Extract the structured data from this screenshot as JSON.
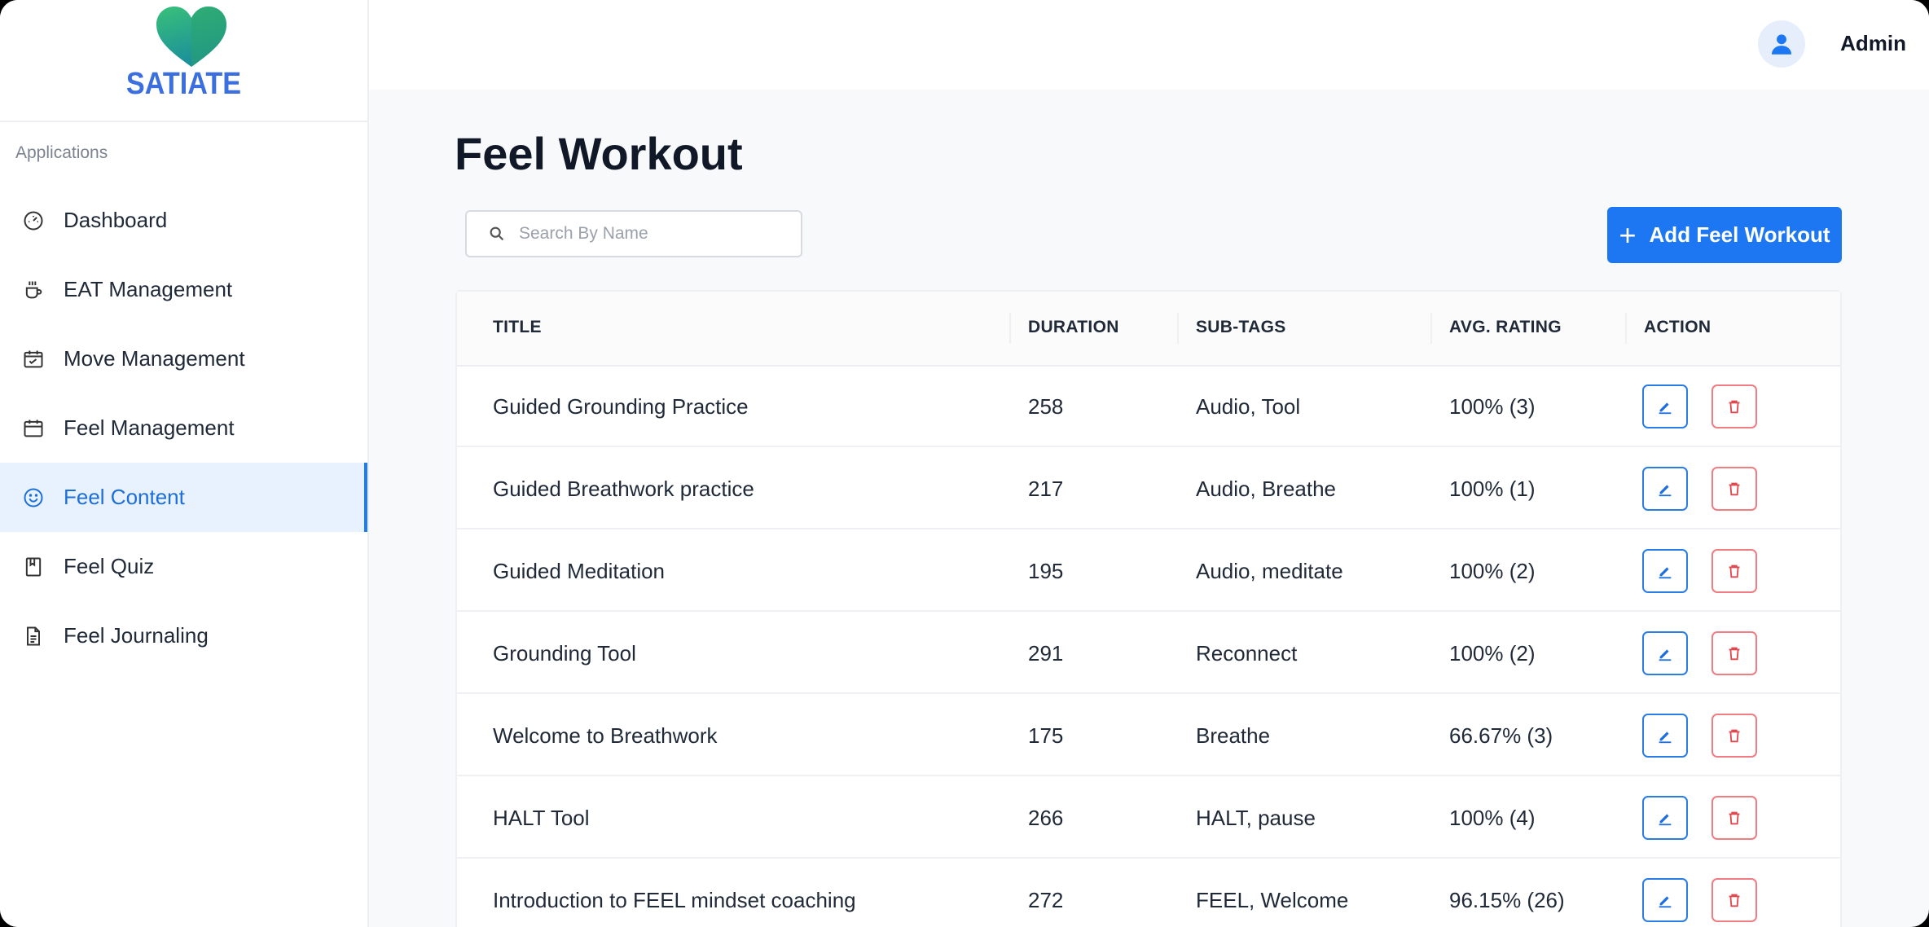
{
  "app": {
    "brand": "SATIATE"
  },
  "sidebar": {
    "section_label": "Applications",
    "items": [
      {
        "label": "Dashboard",
        "icon": "gauge-icon"
      },
      {
        "label": "EAT Management",
        "icon": "coffee-cup-icon"
      },
      {
        "label": "Move Management",
        "icon": "calendar-check-icon"
      },
      {
        "label": "Feel Management",
        "icon": "calendar-icon"
      },
      {
        "label": "Feel Content",
        "icon": "smile-icon",
        "active": true
      },
      {
        "label": "Feel Quiz",
        "icon": "bookmark-book-icon"
      },
      {
        "label": "Feel Journaling",
        "icon": "document-icon"
      }
    ]
  },
  "header": {
    "user_name": "Admin"
  },
  "main": {
    "title": "Feel Workout",
    "search_placeholder": "Search By Name",
    "add_button_label": "Add Feel Workout",
    "table": {
      "columns": [
        "TITLE",
        "DURATION",
        "SUB-TAGS",
        "AVG. RATING",
        "ACTION"
      ],
      "rows": [
        {
          "title": "Guided Grounding Practice",
          "duration": "258",
          "subtags": "Audio,  Tool",
          "rating": "100% (3)"
        },
        {
          "title": "Guided Breathwork practice",
          "duration": "217",
          "subtags": "Audio,  Breathe",
          "rating": "100% (1)"
        },
        {
          "title": "Guided Meditation",
          "duration": "195",
          "subtags": "Audio,  meditate",
          "rating": "100% (2)"
        },
        {
          "title": "Grounding Tool",
          "duration": "291",
          "subtags": "Reconnect",
          "rating": "100% (2)"
        },
        {
          "title": "Welcome to Breathwork",
          "duration": "175",
          "subtags": "Breathe",
          "rating": "66.67% (3)"
        },
        {
          "title": "HALT Tool",
          "duration": "266",
          "subtags": "HALT,  pause",
          "rating": "100% (4)"
        },
        {
          "title": "Introduction to FEEL mindset coaching",
          "duration": "272",
          "subtags": "FEEL,  Welcome",
          "rating": "96.15% (26)"
        }
      ]
    }
  },
  "colors": {
    "accent": "#1d77f2",
    "active_bg": "#e8f2fe",
    "danger": "#ef7d82"
  }
}
